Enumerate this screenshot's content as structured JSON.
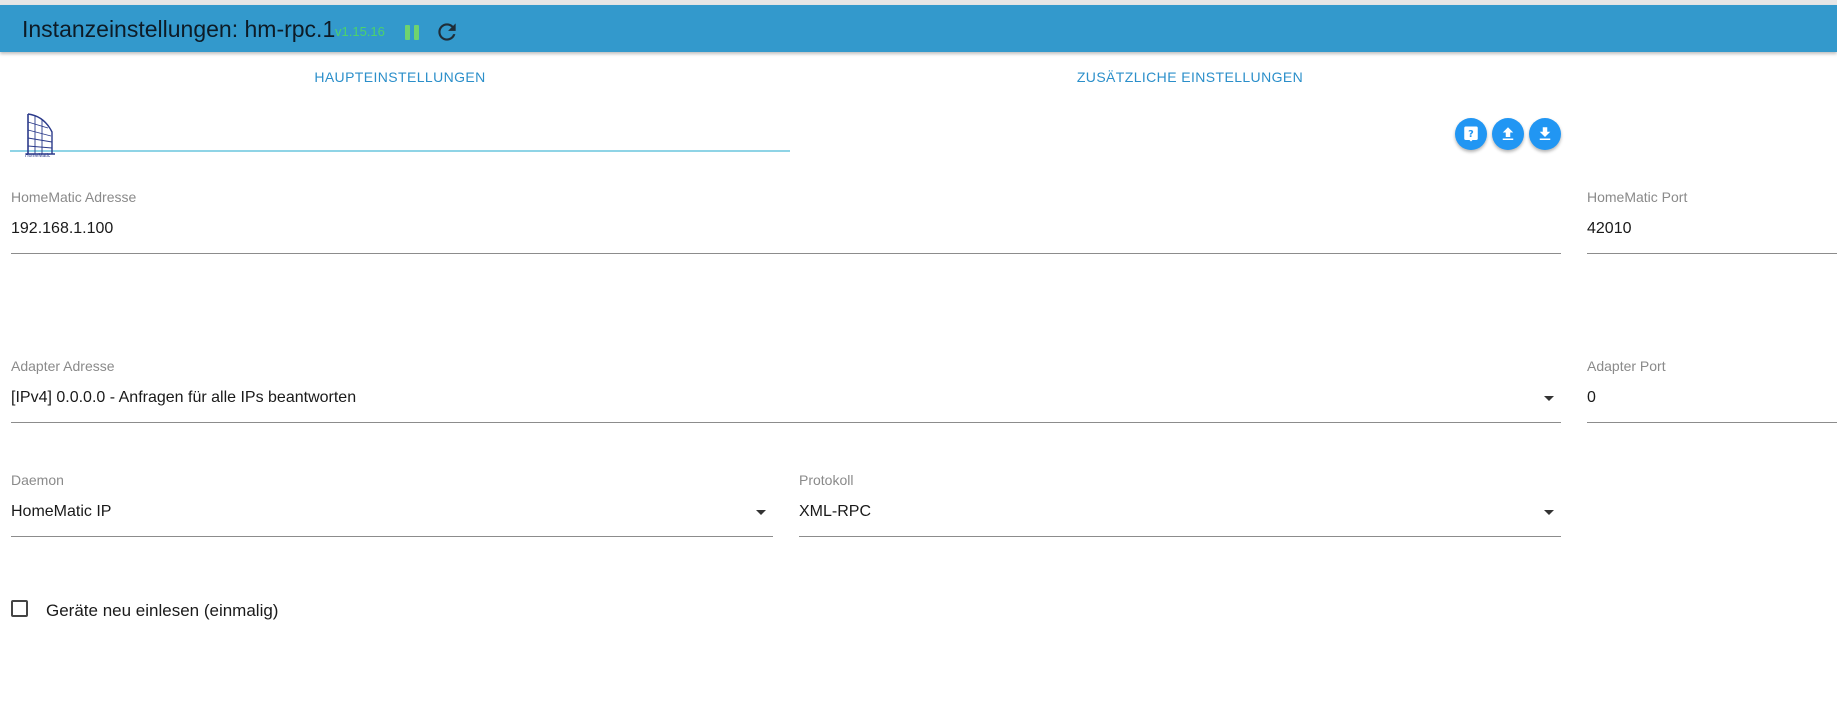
{
  "header": {
    "title": "Instanzeinstellungen: hm-rpc.1",
    "version": "v1.15.16",
    "header_color": "#3399cc",
    "version_color": "#4cd26b"
  },
  "tabs": [
    {
      "label": "HAUPTEINSTELLUNGEN",
      "active": true
    },
    {
      "label": "ZUSÄTZLICHE EINSTELLUNGEN",
      "active": false
    }
  ],
  "toolbar": {
    "icons": [
      "help-icon",
      "upload-icon",
      "download-icon"
    ],
    "button_color": "#2196f3"
  },
  "logo": {
    "caption": "HomeMatic"
  },
  "fields": {
    "homematic_address": {
      "label": "HomeMatic Adresse",
      "value": "192.168.1.100"
    },
    "homematic_port": {
      "label": "HomeMatic Port",
      "value": "42010"
    },
    "adapter_address": {
      "label": "Adapter Adresse",
      "value": "[IPv4] 0.0.0.0 - Anfragen für alle IPs beantworten"
    },
    "adapter_port": {
      "label": "Adapter Port",
      "value": "0"
    },
    "daemon": {
      "label": "Daemon",
      "value": "HomeMatic IP"
    },
    "protocol": {
      "label": "Protokoll",
      "value": "XML-RPC"
    }
  },
  "checkbox": {
    "label": "Geräte neu einlesen (einmalig)",
    "checked": false
  }
}
